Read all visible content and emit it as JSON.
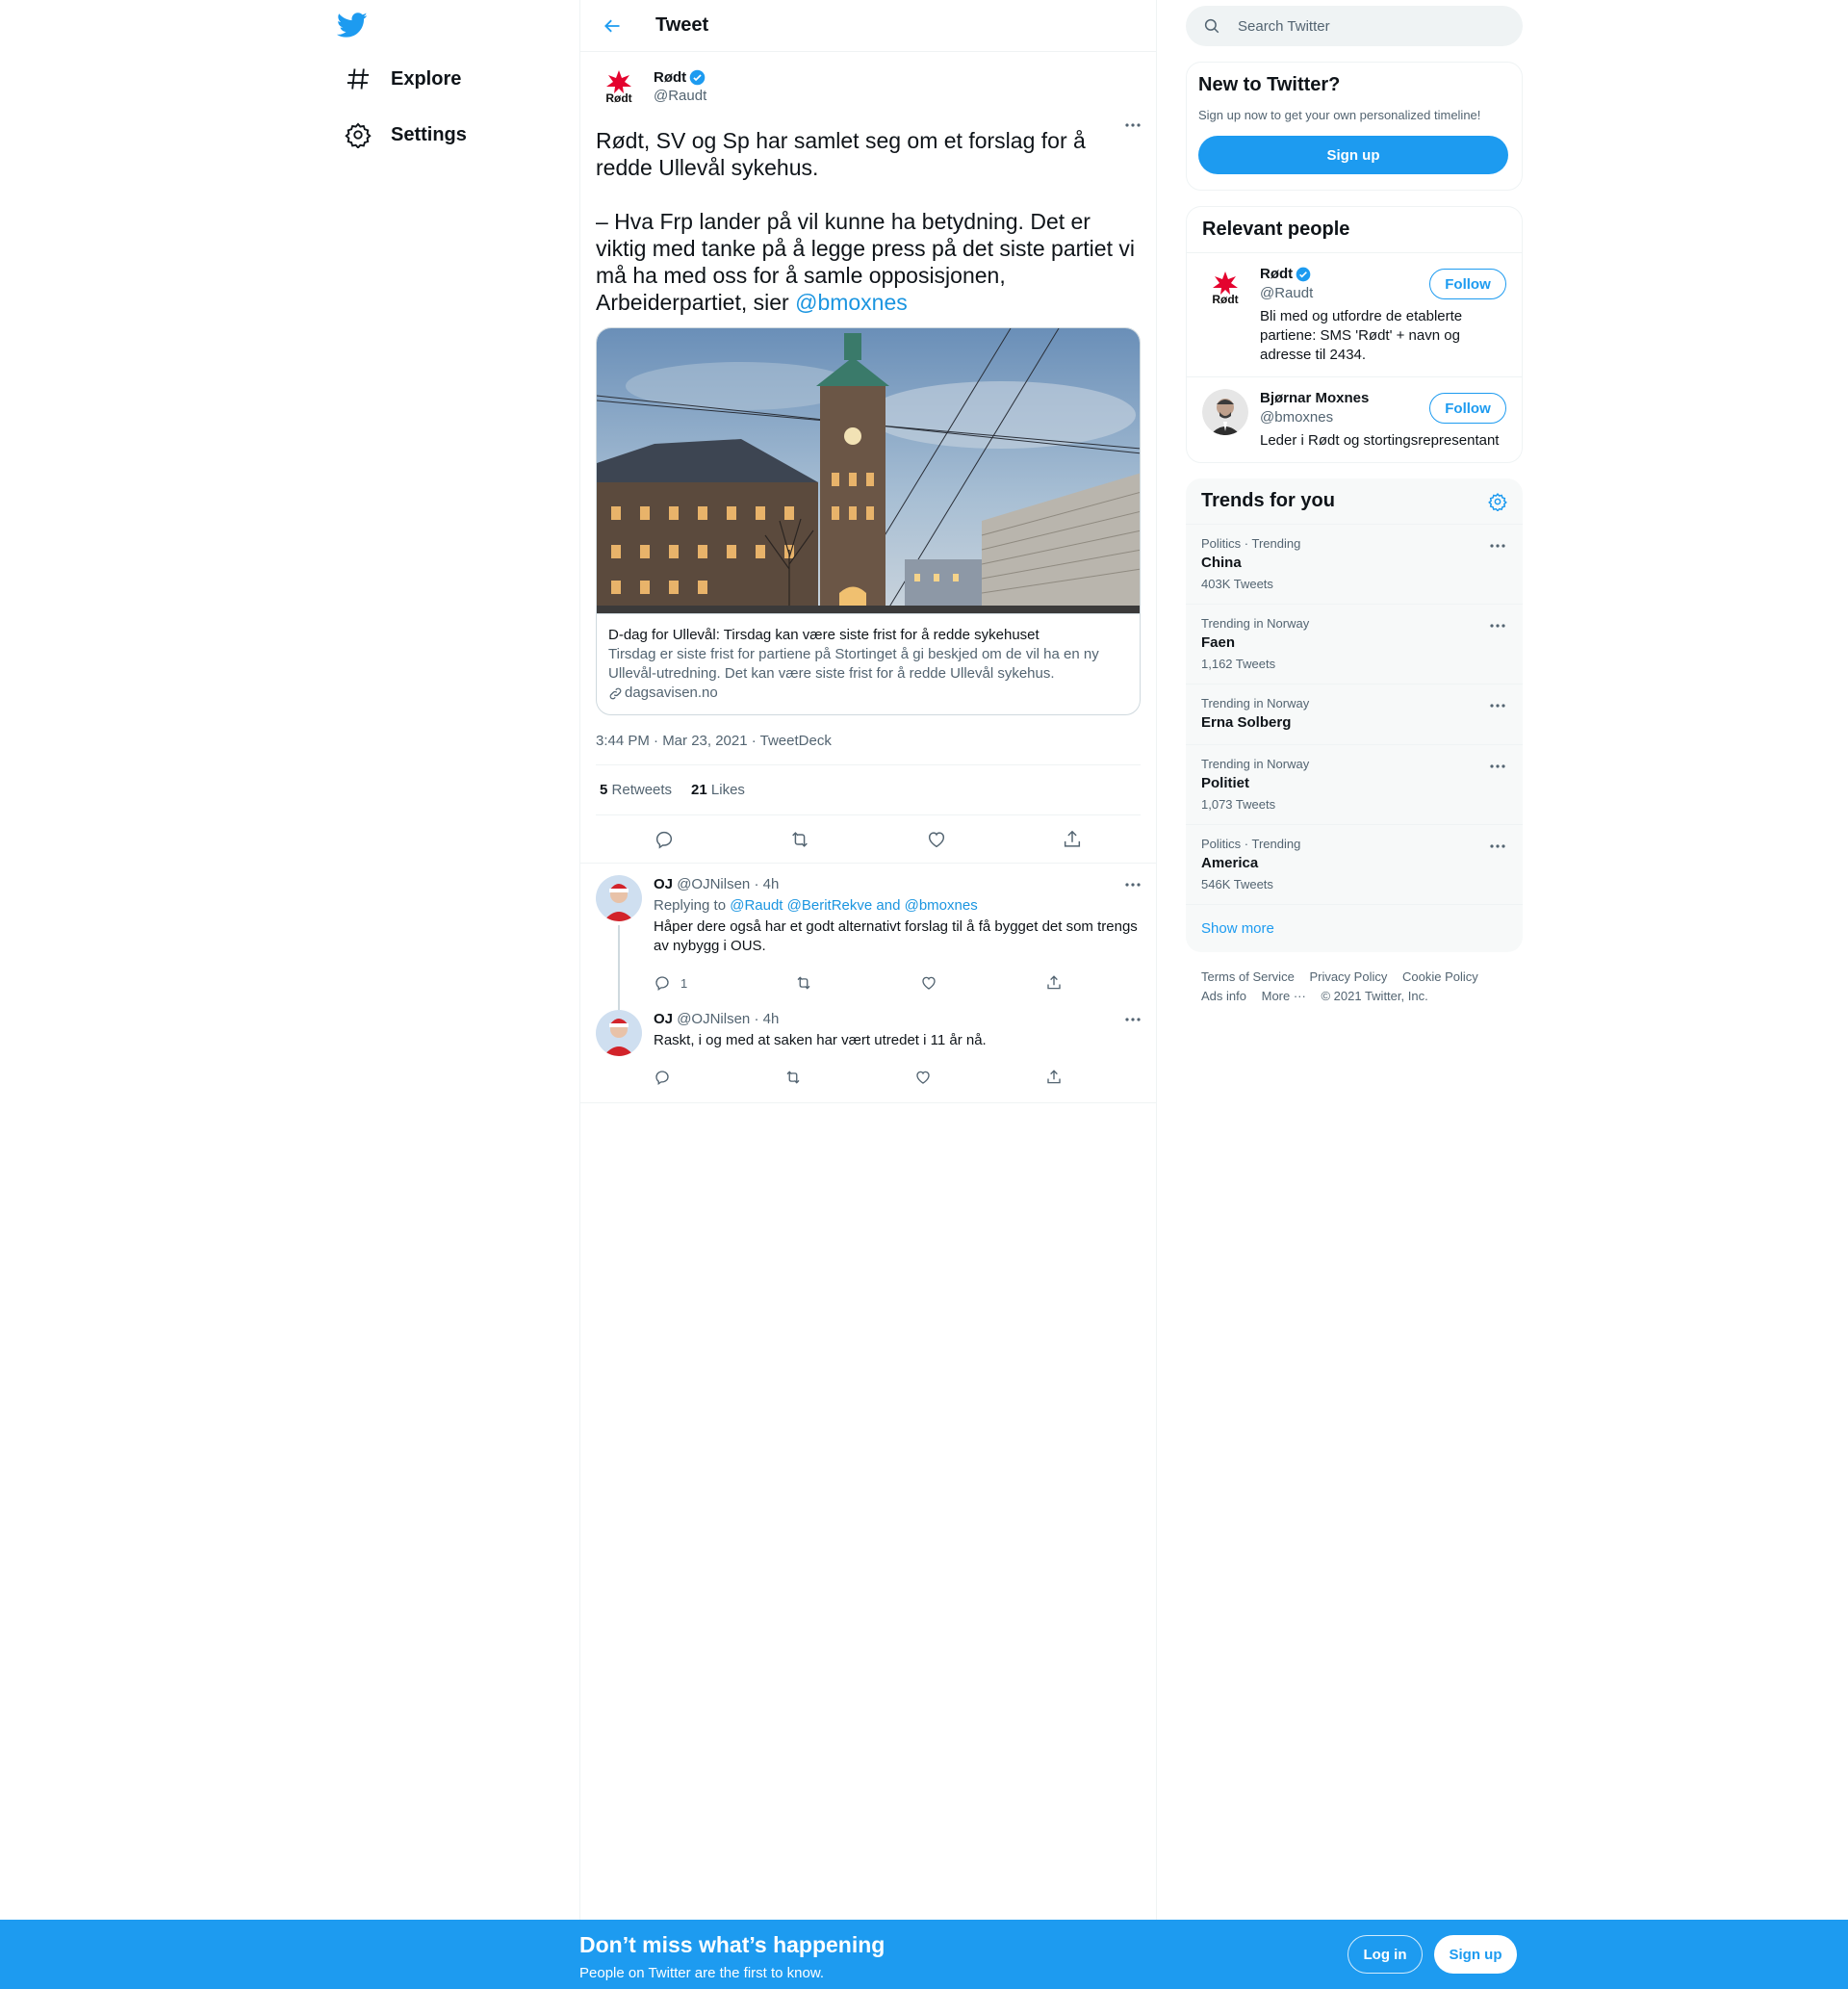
{
  "nav": {
    "logo": "twitter-bird-icon",
    "items": [
      {
        "label": "Explore",
        "icon": "hashtag-icon"
      },
      {
        "label": "Settings",
        "icon": "gear-icon"
      }
    ]
  },
  "header": {
    "title": "Tweet"
  },
  "tweet": {
    "author_name": "Rødt",
    "author_handle": "@Raudt",
    "text_main": "Rødt, SV og Sp har samlet seg om et forslag for å redde Ullevål sykehus.\n\n– Hva Frp lander på vil kunne ha betydning. Det er viktig med tanke på å legge press på det siste partiet vi må ha med oss for å samle opposisjonen, Arbeiderpartiet, sier ",
    "mention": "@bmoxnes",
    "card": {
      "title": "D-dag for Ullevål: Tirsdag kan være siste frist for å redde sykehuset",
      "description": "Tirsdag er siste frist for partiene på Stortinget å gi beskjed om de vil ha en ny Ullevål-utredning. Det kan være siste frist for å redde Ullevål sykehus.",
      "domain": "dagsavisen.no"
    },
    "timestamp": "3:44 PM · Mar 23, 2021 · TweetDeck",
    "retweets": "5",
    "retweets_label": "Retweets",
    "likes": "21",
    "likes_label": "Likes"
  },
  "replies": [
    {
      "name": "OJ",
      "handle": "@OJNilsen",
      "time": "4h",
      "replying_prefix": "Replying to",
      "replying_to": "@Raudt @BeritRekve",
      "replying_and": "and",
      "replying_last": "@bmoxnes",
      "text": "Håper dere også har et godt alternativt forslag til å få bygget det som trengs av nybygg i OUS.",
      "reply_count": "1"
    },
    {
      "name": "OJ",
      "handle": "@OJNilsen",
      "time": "4h",
      "text": "Raskt, i og med at saken har vært utredet i 11 år nå.",
      "reply_count": ""
    }
  ],
  "search": {
    "placeholder": "Search Twitter"
  },
  "new_to_twitter": {
    "title": "New to Twitter?",
    "subtitle": "Sign up now to get your own personalized timeline!",
    "button": "Sign up"
  },
  "relevant_people": {
    "title": "Relevant people",
    "people": [
      {
        "name": "Rødt",
        "handle": "@Raudt",
        "bio": "Bli med og utfordre de etablerte partiene: SMS 'Rødt' + navn og adresse til 2434.",
        "button": "Follow"
      },
      {
        "name": "Bjørnar Moxnes",
        "handle": "@bmoxnes",
        "bio": "Leder i Rødt og stortingsrepresentant",
        "button": "Follow"
      }
    ]
  },
  "trends": {
    "title": "Trends for you",
    "items": [
      {
        "context": "Politics · Trending",
        "name": "China",
        "count": "403K Tweets"
      },
      {
        "context": "Trending in Norway",
        "name": "Faen",
        "count": "1,162 Tweets"
      },
      {
        "context": "Trending in Norway",
        "name": "Erna Solberg",
        "count": ""
      },
      {
        "context": "Trending in Norway",
        "name": "Politiet",
        "count": "1,073 Tweets"
      },
      {
        "context": "Politics · Trending",
        "name": "America",
        "count": "546K Tweets"
      }
    ],
    "show_more": "Show more"
  },
  "footer": {
    "links": [
      "Terms of Service",
      "Privacy Policy",
      "Cookie Policy",
      "Ads info",
      "More ···",
      "© 2021 Twitter, Inc."
    ]
  },
  "bottom_bar": {
    "title": "Don’t miss what’s happening",
    "subtitle": "People on Twitter are the first to know.",
    "login": "Log in",
    "signup": "Sign up"
  },
  "colors": {
    "accent": "#1d9bf0",
    "text": "#0f1419",
    "muted": "#536471"
  }
}
